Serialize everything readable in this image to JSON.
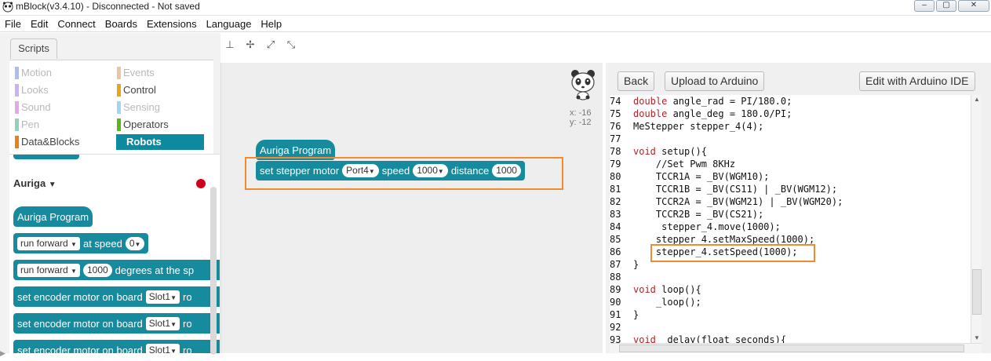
{
  "window": {
    "title": "mBlock(v3.4.10) - Disconnected - Not saved",
    "controls": [
      "–",
      "▢",
      "✕"
    ]
  },
  "menu": [
    "File",
    "Edit",
    "Connect",
    "Boards",
    "Extensions",
    "Language",
    "Help"
  ],
  "left": {
    "tab": "Scripts",
    "categories": [
      {
        "label": "Motion",
        "color": "#4a6cd4",
        "faded": true
      },
      {
        "label": "Events",
        "color": "#c88330",
        "faded": true
      },
      {
        "label": "Looks",
        "color": "#8a55d7",
        "faded": true
      },
      {
        "label": "Control",
        "color": "#e1a91a",
        "faded": false
      },
      {
        "label": "Sound",
        "color": "#bb42c3",
        "faded": true
      },
      {
        "label": "Sensing",
        "color": "#2ca5e2",
        "faded": true
      },
      {
        "label": "Pen",
        "color": "#0e9a6c",
        "faded": true
      },
      {
        "label": "Operators",
        "color": "#5cb712",
        "faded": false
      },
      {
        "label": "Data&Blocks",
        "color": "#ee7d16",
        "faded": false
      },
      {
        "label": "Robots",
        "color": "#0e8aa0",
        "faded": false,
        "active": true
      }
    ],
    "section_label": "Auriga",
    "section_arrow": "▼",
    "blocks": {
      "hat": "Auriga Program",
      "b1_text": "run forward",
      "b1_mid": "at speed",
      "b1_val": "0",
      "b2_text": "run forward",
      "b2_val": "1000",
      "b2_tail": "degrees at the sp",
      "b3_text": "set encoder motor on board",
      "b3_slot": "Slot1",
      "b3_tail": "ro",
      "b4_text": "set encoder motor on board",
      "b4_slot": "Slot1",
      "b4_tail": "ro",
      "b5_text": "set encoder motor on board",
      "b5_slot": "Slot1",
      "b5_tail": "ro"
    }
  },
  "toolbar": [
    "⊥",
    "✢",
    "⤢",
    "⤡"
  ],
  "canvas": {
    "hat": "Auriga Program",
    "block_text": "set stepper motor",
    "port": "Port4",
    "speed_label": "speed",
    "speed_val": "1000",
    "distance_label": "distance",
    "distance_val": "1000",
    "coord_x": "x: -16",
    "coord_y": "y: -12"
  },
  "right": {
    "back": "Back",
    "upload": "Upload to Arduino",
    "edit_ide": "Edit with Arduino IDE",
    "code": [
      {
        "n": "74",
        "kw": "double",
        "rest": " angle_rad = PI/180.0;"
      },
      {
        "n": "75",
        "kw": "double",
        "rest": " angle_deg = 180.0/PI;"
      },
      {
        "n": "76",
        "kw": "",
        "rest": "MeStepper stepper_4(4);"
      },
      {
        "n": "77",
        "kw": "",
        "rest": ""
      },
      {
        "n": "78",
        "kw": "void",
        "rest": " setup(){"
      },
      {
        "n": "79",
        "kw": "",
        "rest": "    //Set Pwm 8KHz"
      },
      {
        "n": "80",
        "kw": "",
        "rest": "    TCCR1A = _BV(WGM10);"
      },
      {
        "n": "81",
        "kw": "",
        "rest": "    TCCR1B = _BV(CS11) | _BV(WGM12);"
      },
      {
        "n": "82",
        "kw": "",
        "rest": "    TCCR2A = _BV(WGM21) | _BV(WGM20);"
      },
      {
        "n": "83",
        "kw": "",
        "rest": "    TCCR2B = _BV(CS21);"
      },
      {
        "n": "84",
        "kw": "",
        "rest": "     stepper_4.move(1000);"
      },
      {
        "n": "85",
        "kw": "",
        "rest": "    stepper_4.setMaxSpeed(1000);"
      },
      {
        "n": "86",
        "kw": "",
        "rest": "    stepper_4.setSpeed(1000);"
      },
      {
        "n": "87",
        "kw": "",
        "rest": "}"
      },
      {
        "n": "88",
        "kw": "",
        "rest": ""
      },
      {
        "n": "89",
        "kw": "void",
        "rest": " loop(){"
      },
      {
        "n": "90",
        "kw": "",
        "rest": "    _loop();"
      },
      {
        "n": "91",
        "kw": "",
        "rest": "}"
      },
      {
        "n": "92",
        "kw": "",
        "rest": ""
      },
      {
        "n": "93",
        "kw": "void",
        "rest": " _delay(float seconds){"
      }
    ]
  }
}
